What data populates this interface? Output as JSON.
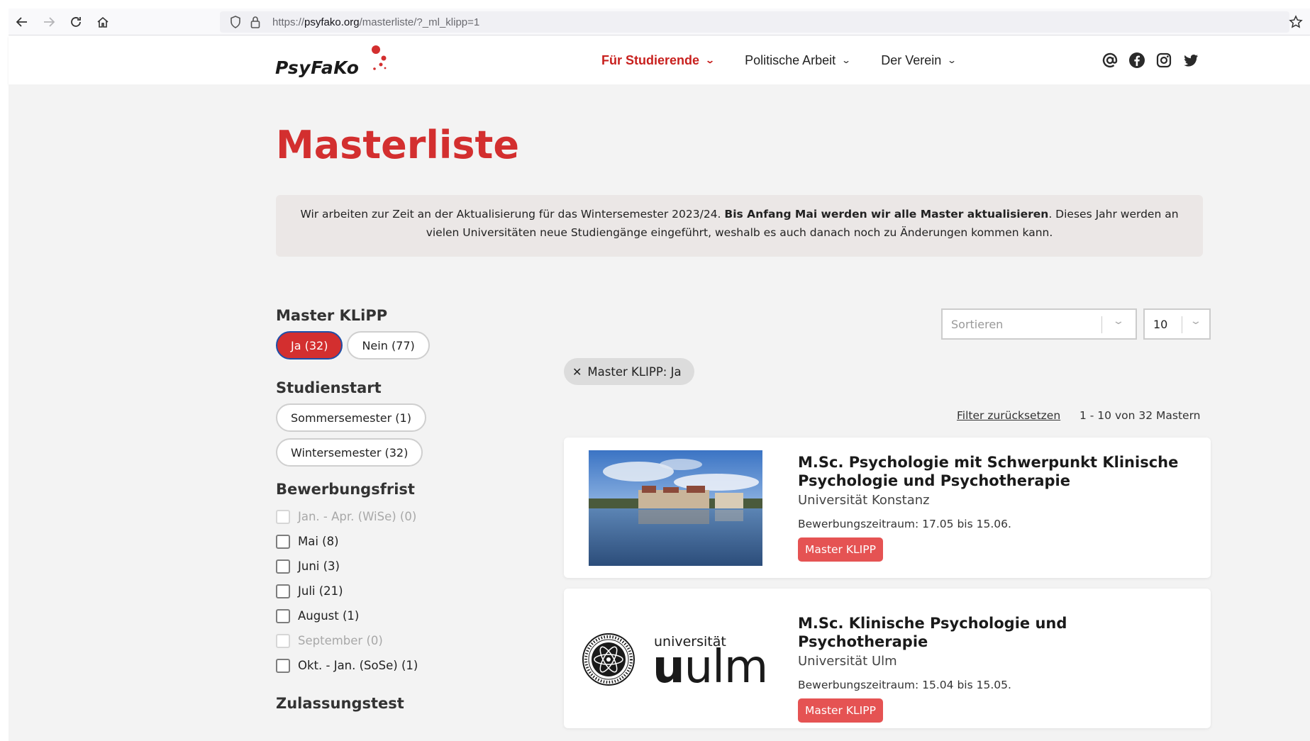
{
  "browser": {
    "url_prefix": "https://",
    "url_host": "psyfako.org",
    "url_path": "/masterliste/?_ml_klipp=1"
  },
  "header": {
    "logo_text": "PsyFaKo",
    "nav": [
      {
        "label": "Für Studierende",
        "active": true
      },
      {
        "label": "Politische Arbeit",
        "active": false
      },
      {
        "label": "Der Verein",
        "active": false
      }
    ],
    "social_icons": [
      "at-icon",
      "facebook-icon",
      "instagram-icon",
      "twitter-icon"
    ]
  },
  "page": {
    "title": "Masterliste",
    "notice_part1": "Wir arbeiten zur Zeit an der Aktualisierung für das Wintersemester 2023/24. ",
    "notice_bold": "Bis Anfang Mai werden wir alle Master aktualisieren",
    "notice_part2": ". Dieses Jahr werden an vielen Universitäten neue Studiengänge eingeführt, weshalb es auch danach noch zu Änderungen kommen kann."
  },
  "filters": {
    "klipp": {
      "heading": "Master KLiPP",
      "options": [
        {
          "label": "Ja (32)",
          "active": true
        },
        {
          "label": "Nein (77)",
          "active": false
        }
      ]
    },
    "studienstart": {
      "heading": "Studienstart",
      "options": [
        {
          "label": "Sommersemester (1)"
        },
        {
          "label": "Wintersemester (32)"
        }
      ]
    },
    "bewerbungsfrist": {
      "heading": "Bewerbungsfrist",
      "options": [
        {
          "label": "Jan. - Apr. (WiSe) (0)",
          "disabled": true
        },
        {
          "label": "Mai (8)",
          "disabled": false
        },
        {
          "label": "Juni (3)",
          "disabled": false
        },
        {
          "label": "Juli (21)",
          "disabled": false
        },
        {
          "label": "August (1)",
          "disabled": false
        },
        {
          "label": "September (0)",
          "disabled": true
        },
        {
          "label": "Okt. - Jan. (SoSe) (1)",
          "disabled": false
        }
      ]
    },
    "zulassungstest": {
      "heading": "Zulassungstest"
    }
  },
  "results": {
    "sort_placeholder": "Sortieren",
    "per_page": "10",
    "active_filter": "Master KLIPP: Ja",
    "reset_label": "Filter zurücksetzen",
    "count_label": "1 - 10 von 32 Mastern",
    "items": [
      {
        "title": "M.Sc. Psychologie mit Schwerpunkt Klinische Psychologie und Psychotherapie",
        "university": "Universität Konstanz",
        "period": "Bewerbungszeitraum: 17.05 bis 15.06.",
        "badge": "Master KLIPP"
      },
      {
        "title": "M.Sc. Klinische Psychologie und Psychotherapie",
        "university": "Universität Ulm",
        "period": "Bewerbungszeitraum: 15.04 bis 15.05.",
        "badge": "Master KLIPP",
        "logo_small": "universität",
        "logo_big_bold": "u",
        "logo_big": "ulm"
      }
    ]
  },
  "colors": {
    "brand_red": "#d32f2f",
    "badge_red": "#e55353",
    "notice_bg": "#ebe7e6"
  }
}
